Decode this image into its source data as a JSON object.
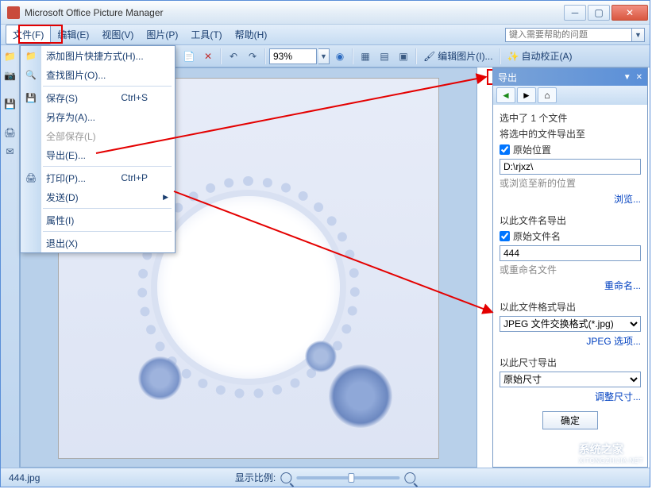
{
  "window": {
    "title": "Microsoft Office Picture Manager"
  },
  "menubar": {
    "file": "文件(F)",
    "edit": "编辑(E)",
    "view": "视图(V)",
    "picture": "图片(P)",
    "tools": "工具(T)",
    "help": "帮助(H)",
    "help_placeholder": "键入需要帮助的问题"
  },
  "toolbar": {
    "zoom_value": "93%",
    "edit_pictures": "编辑图片(I)...",
    "auto_correct": "自动校正(A)"
  },
  "filemenu": {
    "add_shortcut": "添加图片快捷方式(H)...",
    "find_pictures": "查找图片(O)...",
    "save": "保存(S)",
    "save_sc": "Ctrl+S",
    "save_as": "另存为(A)...",
    "save_all": "全部保存(L)",
    "export": "导出(E)...",
    "print": "打印(P)...",
    "print_sc": "Ctrl+P",
    "send": "发送(D)",
    "properties": "属性(I)",
    "exit": "退出(X)"
  },
  "taskpane": {
    "title": "导出",
    "selected": "选中了 1 个文件",
    "export_to": "将选中的文件导出至",
    "orig_location": "原始位置",
    "path_value": "D:\\rjxz\\",
    "browse_hint": "或浏览至新的位置",
    "browse": "浏览...",
    "export_name": "以此文件名导出",
    "orig_name": "原始文件名",
    "name_value": "444",
    "rename_hint": "或重命名文件",
    "rename": "重命名...",
    "export_format": "以此文件格式导出",
    "format_value": "JPEG 文件交换格式(*.jpg)",
    "jpeg_options": "JPEG 选项...",
    "export_size": "以此尺寸导出",
    "size_value": "原始尺寸",
    "resize": "调整尺寸...",
    "ok": "确定"
  },
  "statusbar": {
    "filename": "444.jpg",
    "zoom_label": "显示比例:"
  },
  "watermark": {
    "line1": "系统之家",
    "line2": "XITONGZHIJIA.NET"
  }
}
